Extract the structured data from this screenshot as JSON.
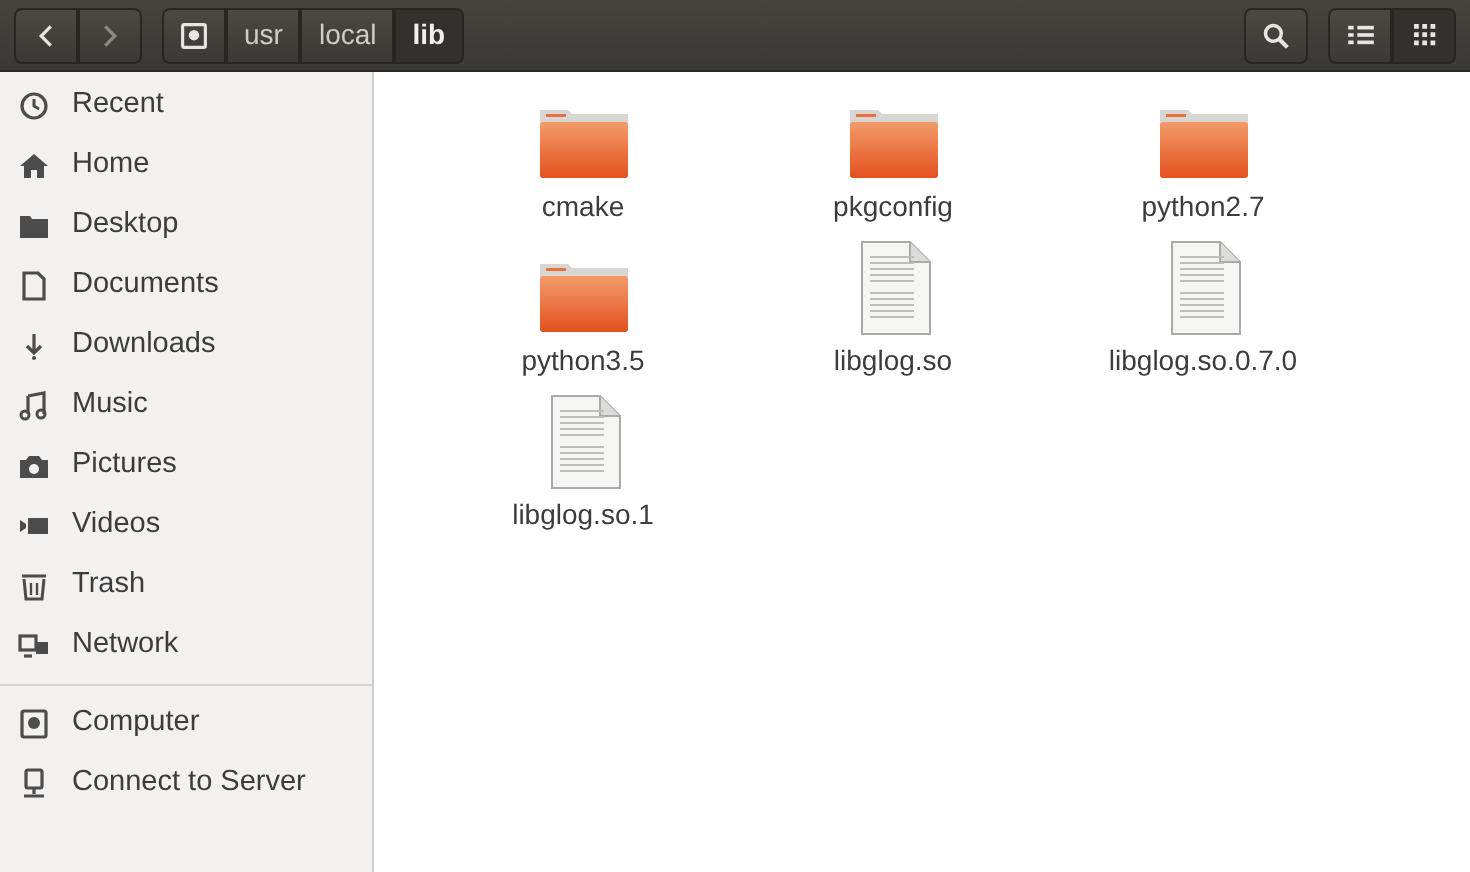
{
  "toolbar": {
    "back": {
      "disabled": false
    },
    "forward": {
      "disabled": true
    },
    "path": [
      {
        "label": "usr",
        "selected": false
      },
      {
        "label": "local",
        "selected": false
      },
      {
        "label": "lib",
        "selected": true
      }
    ],
    "views": [
      {
        "kind": "list",
        "selected": false
      },
      {
        "kind": "grid",
        "selected": true
      }
    ]
  },
  "sidebar": {
    "places": [
      {
        "label": "Recent"
      },
      {
        "label": "Home"
      },
      {
        "label": "Desktop"
      },
      {
        "label": "Documents"
      },
      {
        "label": "Downloads"
      },
      {
        "label": "Music"
      },
      {
        "label": "Pictures"
      },
      {
        "label": "Videos"
      },
      {
        "label": "Trash"
      },
      {
        "label": "Network"
      }
    ],
    "devices": [
      {
        "label": "Computer"
      },
      {
        "label": "Connect to Server"
      }
    ]
  },
  "files": [
    {
      "name": "cmake",
      "kind": "folder"
    },
    {
      "name": "pkgconfig",
      "kind": "folder"
    },
    {
      "name": "python2.7",
      "kind": "folder"
    },
    {
      "name": "python3.5",
      "kind": "folder"
    },
    {
      "name": "libglog.so",
      "kind": "file"
    },
    {
      "name": "libglog.so.0.7.0",
      "kind": "file"
    },
    {
      "name": "libglog.so.1",
      "kind": "file"
    }
  ]
}
